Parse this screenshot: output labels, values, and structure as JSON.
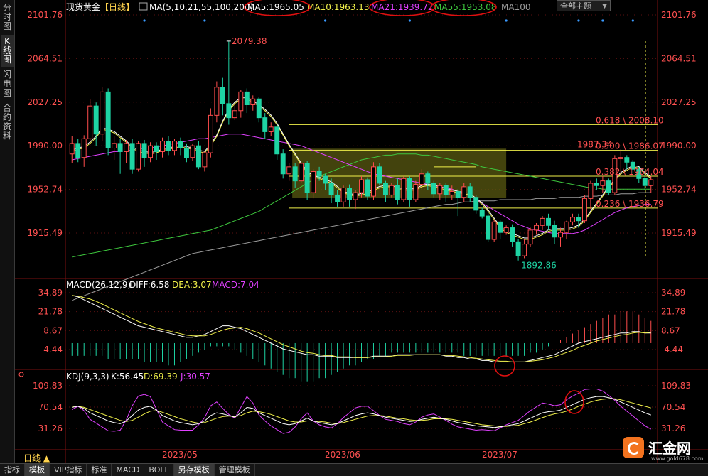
{
  "side_tabs": [
    "分时图",
    "K线图",
    "闪电图",
    "合约资料"
  ],
  "side_active": 1,
  "header": {
    "symbol": "现货黄金",
    "period_tag": "【日线】",
    "ma_label": "MA(5,10,21,55,100,200)",
    "ma5": "MA5:1965.05",
    "ma10": "MA10:1963.13",
    "ma21": "MA21:1939.72",
    "ma55": "MA55:1953.08",
    "ma100": "MA100",
    "theme": "全部主题"
  },
  "colors": {
    "up": "#ff4d4d",
    "down": "#1ed4a4",
    "ma5": "#ffffff",
    "ma10": "#f0f04a",
    "ma21": "#e040ff",
    "ma55": "#3ec83e",
    "ma100": "#9a9a9a",
    "axis_text": "#ff5050",
    "grid": "#5a1010"
  },
  "price_axis": {
    "ticks": [
      "2101.76",
      "2064.51",
      "2027.25",
      "1990.00",
      "1952.74",
      "1915.49"
    ],
    "values": [
      2101.76,
      2064.51,
      2027.25,
      1990.0,
      1952.74,
      1915.49
    ]
  },
  "annotations": {
    "high": "2079.38",
    "low": "1892.86",
    "recent_high": "1987.34"
  },
  "fib": [
    {
      "label": "0.618 \\ 2008.10",
      "value": 2008.1
    },
    {
      "label": "0.500 \\ 1986.07",
      "value": 1986.07
    },
    {
      "label": "0.382 \\ 1964.04",
      "value": 1964.04
    },
    {
      "label": "0.236 \\ 1936.79",
      "value": 1936.79
    }
  ],
  "macd": {
    "label": "MACD(26,12,9)",
    "diff": "DIFF:6.58",
    "dea": "DEA:3.07",
    "macd": "MACD:7.04",
    "ticks": [
      "34.89",
      "21.78",
      "8.67",
      "-4.44"
    ],
    "values": [
      34.89,
      21.78,
      8.67,
      -4.44
    ]
  },
  "kdj": {
    "label": "KDJ(9,3,3)",
    "k": "K:56.45",
    "d": "D:69.39",
    "j": "J:30.57",
    "ticks": [
      "109.83",
      "70.54",
      "31.26"
    ],
    "values": [
      109.83,
      70.54,
      31.26
    ]
  },
  "dates": [
    "2023/05",
    "2023/06",
    "2023/07"
  ],
  "period_button": "日线 ▲",
  "bottom_tabs": [
    "指标",
    "模板",
    "VIP指标",
    "标准",
    "MACD",
    "BOLL",
    "另存模板",
    "管理模板"
  ],
  "bottom_active": [
    1,
    6
  ],
  "logo": {
    "name": "汇金网",
    "url": "www.gold678.com"
  },
  "chart_data": {
    "type": "candlestick",
    "candles": [
      [
        1983,
        1992,
        1975,
        1998
      ],
      [
        1992,
        1980,
        1976,
        1996
      ],
      [
        1980,
        1996,
        1972,
        1999
      ],
      [
        1996,
        2024,
        1994,
        2030
      ],
      [
        2024,
        2000,
        1990,
        2027
      ],
      [
        2000,
        2036,
        1994,
        2040
      ],
      [
        2036,
        1988,
        1982,
        2039
      ],
      [
        1988,
        1992,
        1978,
        1998
      ],
      [
        1992,
        1985,
        1966,
        1996
      ],
      [
        1985,
        1992,
        1975,
        1995
      ],
      [
        1992,
        1970,
        1966,
        1996
      ],
      [
        1970,
        1992,
        1968,
        1994
      ],
      [
        1992,
        1980,
        1972,
        1995
      ],
      [
        1980,
        1990,
        1976,
        1993
      ],
      [
        1990,
        1985,
        1978,
        1993
      ],
      [
        1985,
        1994,
        1980,
        1997
      ],
      [
        1994,
        1986,
        1982,
        1998
      ],
      [
        1986,
        1994,
        1982,
        1996
      ],
      [
        1994,
        1988,
        1982,
        1997
      ],
      [
        1988,
        1980,
        1976,
        1992
      ],
      [
        1980,
        1990,
        1977,
        1992
      ],
      [
        1990,
        1972,
        1970,
        1994
      ],
      [
        1972,
        1984,
        1968,
        1985
      ],
      [
        1984,
        2016,
        1980,
        2022
      ],
      [
        2016,
        2040,
        2010,
        2045
      ],
      [
        2040,
        2026,
        2016,
        2048
      ],
      [
        2026,
        2014,
        2008,
        2079
      ],
      [
        2014,
        2020,
        2012,
        2025
      ],
      [
        2020,
        2036,
        2014,
        2038
      ],
      [
        2036,
        2025,
        2018,
        2039
      ],
      [
        2025,
        2030,
        2020,
        2033
      ],
      [
        2030,
        2014,
        2010,
        2032
      ],
      [
        2014,
        2002,
        1996,
        2018
      ],
      [
        2002,
        2006,
        1998,
        2010
      ],
      [
        2006,
        1983,
        1978,
        2008
      ],
      [
        1983,
        1966,
        1962,
        1987
      ],
      [
        1966,
        1972,
        1960,
        1975
      ],
      [
        1972,
        1960,
        1954,
        1975
      ],
      [
        1960,
        1975,
        1958,
        1976
      ],
      [
        1975,
        1950,
        1944,
        1977
      ],
      [
        1950,
        1968,
        1945,
        1970
      ],
      [
        1968,
        1964,
        1960,
        1972
      ],
      [
        1964,
        1958,
        1952,
        1966
      ],
      [
        1958,
        1948,
        1941,
        1962
      ],
      [
        1948,
        1942,
        1938,
        1952
      ],
      [
        1942,
        1954,
        1938,
        1956
      ],
      [
        1954,
        1944,
        1938,
        1957
      ],
      [
        1944,
        1950,
        1936,
        1952
      ],
      [
        1950,
        1961,
        1946,
        1964
      ],
      [
        1961,
        1947,
        1944,
        1963
      ],
      [
        1947,
        1972,
        1944,
        1976
      ],
      [
        1972,
        1958,
        1956,
        1975
      ],
      [
        1958,
        1948,
        1942,
        1960
      ],
      [
        1948,
        1956,
        1946,
        1958
      ],
      [
        1956,
        1944,
        1940,
        1962
      ],
      [
        1944,
        1962,
        1942,
        1964
      ],
      [
        1962,
        1944,
        1938,
        1964
      ],
      [
        1944,
        1957,
        1942,
        1960
      ],
      [
        1957,
        1966,
        1954,
        1970
      ],
      [
        1966,
        1958,
        1952,
        1968
      ],
      [
        1958,
        1949,
        1946,
        1960
      ],
      [
        1949,
        1956,
        1944,
        1958
      ],
      [
        1956,
        1948,
        1942,
        1958
      ],
      [
        1948,
        1951,
        1944,
        1956
      ],
      [
        1951,
        1946,
        1930,
        1953
      ],
      [
        1946,
        1955,
        1942,
        1958
      ],
      [
        1955,
        1946,
        1942,
        1958
      ],
      [
        1946,
        1935,
        1932,
        1948
      ],
      [
        1935,
        1930,
        1928,
        1937
      ],
      [
        1930,
        1910,
        1908,
        1933
      ],
      [
        1910,
        1925,
        1908,
        1927
      ],
      [
        1925,
        1916,
        1910,
        1927
      ],
      [
        1916,
        1920,
        1914,
        1922
      ],
      [
        1920,
        1908,
        1904,
        1923
      ],
      [
        1908,
        1896,
        1892,
        1910
      ],
      [
        1896,
        1906,
        1894,
        1910
      ],
      [
        1906,
        1918,
        1904,
        1920
      ],
      [
        1918,
        1922,
        1914,
        1924
      ],
      [
        1922,
        1928,
        1918,
        1930
      ],
      [
        1928,
        1922,
        1918,
        1932
      ],
      [
        1922,
        1912,
        1906,
        1926
      ],
      [
        1912,
        1916,
        1904,
        1920
      ],
      [
        1916,
        1925,
        1910,
        1926
      ],
      [
        1925,
        1929,
        1922,
        1932
      ],
      [
        1929,
        1926,
        1920,
        1932
      ],
      [
        1926,
        1945,
        1924,
        1948
      ],
      [
        1945,
        1958,
        1936,
        1960
      ],
      [
        1958,
        1956,
        1952,
        1962
      ],
      [
        1956,
        1960,
        1950,
        1964
      ],
      [
        1960,
        1950,
        1948,
        1962
      ],
      [
        1950,
        1979,
        1948,
        1982
      ],
      [
        1979,
        1980,
        1966,
        1987
      ],
      [
        1980,
        1976,
        1970,
        1982
      ],
      [
        1976,
        1970,
        1966,
        1978
      ],
      [
        1970,
        1962,
        1958,
        1972
      ],
      [
        1962,
        1956,
        1952,
        1966
      ],
      [
        1956,
        1961,
        1950,
        1964
      ]
    ],
    "ma5": [
      1985,
      1987,
      1988,
      1992,
      1997,
      2004,
      2003,
      2001,
      1997,
      1993,
      1988,
      1985,
      1984,
      1983,
      1984,
      1986,
      1987,
      1988,
      1989,
      1988,
      1987,
      1985,
      1984,
      1990,
      1998,
      2010,
      2020,
      2026,
      2030,
      2030,
      2027,
      2024,
      2020,
      2015,
      2008,
      1999,
      1990,
      1982,
      1974,
      1967,
      1963,
      1962,
      1960,
      1958,
      1954,
      1950,
      1948,
      1947,
      1948,
      1949,
      1952,
      1954,
      1955,
      1955,
      1953,
      1952,
      1952,
      1952,
      1955,
      1956,
      1955,
      1954,
      1952,
      1951,
      1950,
      1949,
      1948,
      1944,
      1940,
      1934,
      1927,
      1920,
      1916,
      1914,
      1912,
      1910,
      1910,
      1912,
      1914,
      1917,
      1918,
      1918,
      1918,
      1919,
      1921,
      1926,
      1933,
      1940,
      1947,
      1954,
      1960,
      1966,
      1969,
      1972,
      1971,
      1966,
      1962
    ],
    "ma21": [
      1978,
      1979,
      1980,
      1981,
      1982,
      1983,
      1984,
      1985,
      1985,
      1986,
      1986,
      1987,
      1988,
      1988,
      1989,
      1990,
      1991,
      1992,
      1993,
      1994,
      1995,
      1996,
      1996,
      1997,
      1998,
      1999,
      2000,
      2000,
      2000,
      1999,
      1998,
      1997,
      1996,
      1995,
      1994,
      1993,
      1992,
      1991,
      1990,
      1988,
      1986,
      1984,
      1982,
      1980,
      1978,
      1976,
      1974,
      1972,
      1970,
      1968,
      1966,
      1965,
      1964,
      1963,
      1962,
      1961,
      1960,
      1959,
      1958,
      1957,
      1956,
      1955,
      1954,
      1953,
      1951,
      1949,
      1947,
      1944,
      1941,
      1938,
      1935,
      1932,
      1929,
      1926,
      1923,
      1921,
      1919,
      1918,
      1917,
      1916,
      1915,
      1915,
      1915,
      1915,
      1916,
      1918,
      1921,
      1924,
      1927,
      1930,
      1933,
      1935,
      1937,
      1938,
      1939,
      1940,
      1940
    ],
    "ma55": [
      1895,
      1896,
      1897,
      1898,
      1899,
      1900,
      1901,
      1902,
      1903,
      1904,
      1905,
      1906,
      1907,
      1908,
      1909,
      1910,
      1911,
      1912,
      1913,
      1914,
      1915,
      1916,
      1917,
      1918,
      1920,
      1922,
      1924,
      1926,
      1928,
      1930,
      1932,
      1934,
      1937,
      1940,
      1943,
      1946,
      1949,
      1952,
      1955,
      1958,
      1961,
      1964,
      1966,
      1968,
      1970,
      1972,
      1974,
      1976,
      1978,
      1979,
      1980,
      1981,
      1982,
      1982,
      1983,
      1983,
      1983,
      1983,
      1982,
      1982,
      1981,
      1980,
      1979,
      1978,
      1977,
      1976,
      1975,
      1974,
      1972,
      1971,
      1970,
      1969,
      1968,
      1967,
      1966,
      1965,
      1964,
      1963,
      1962,
      1961,
      1960,
      1959,
      1958,
      1957,
      1956,
      1955,
      1954,
      1954,
      1953,
      1953,
      1953,
      1953,
      1953,
      1953,
      1953,
      1953,
      1953
    ],
    "ma100": [
      1858,
      1860,
      1862,
      1864,
      1866,
      1868,
      1870,
      1872,
      1874,
      1876,
      1878,
      1880,
      1882,
      1884,
      1886,
      1888,
      1890,
      1892,
      1894,
      1896,
      1898,
      1899,
      1900,
      1901,
      1902,
      1903,
      1904,
      1905,
      1906,
      1907,
      1908,
      1909,
      1910,
      1911,
      1912,
      1913,
      1914,
      1915,
      1916,
      1917,
      1918,
      1919,
      1920,
      1921,
      1922,
      1923,
      1924,
      1925,
      1926,
      1927,
      1928,
      1929,
      1930,
      1931,
      1932,
      1933,
      1934,
      1935,
      1936,
      1937,
      1938,
      1939,
      1940,
      1940,
      1941,
      1942,
      1942,
      1943,
      1943,
      1943,
      1943,
      1944,
      1944,
      1944,
      1944,
      1944,
      1944,
      1945,
      1945,
      1945,
      1945,
      1946,
      1946,
      1946,
      1946,
      1947,
      1947,
      1947,
      1948,
      1948,
      1948,
      1949,
      1949,
      1949,
      1950,
      1950,
      1950
    ],
    "macd_hist": [
      -4,
      -4,
      -4,
      -4,
      -4,
      -4,
      -5,
      -5,
      -5,
      -5,
      -5,
      -5,
      -6,
      -6,
      -6,
      -6,
      -7,
      -7,
      -6,
      -5,
      -4,
      -3,
      -2,
      -1,
      -1,
      -1,
      -1,
      -2,
      -3,
      -4,
      -5,
      -6,
      -7,
      -8,
      -9,
      -10,
      -11,
      -11,
      -12,
      -12,
      -12,
      -11,
      -11,
      -10,
      -9,
      -8,
      -7,
      -7,
      -6,
      -5,
      -5,
      -4,
      -4,
      -3,
      -3,
      -3,
      -3,
      -3,
      -3,
      -3,
      -3,
      -3,
      -3,
      -3,
      -3,
      -4,
      -4,
      -4,
      -4,
      -4,
      -4,
      -4,
      -4,
      -4,
      -4,
      -4,
      -3,
      -3,
      -2,
      -1,
      0,
      1,
      2,
      3,
      4,
      5,
      6,
      7,
      8,
      9,
      9,
      10,
      10,
      10,
      9,
      8,
      7
    ],
    "macd_diff": [
      33,
      32,
      30,
      28,
      26,
      24,
      22,
      20,
      18,
      16,
      14,
      12,
      11,
      10,
      9,
      8,
      7,
      6,
      5,
      4,
      4,
      5,
      6,
      8,
      10,
      12,
      12,
      11,
      10,
      8,
      6,
      4,
      2,
      0,
      -2,
      -4,
      -5,
      -6,
      -7,
      -8,
      -8,
      -9,
      -9,
      -9,
      -10,
      -10,
      -10,
      -10,
      -10,
      -10,
      -9,
      -9,
      -9,
      -9,
      -8,
      -8,
      -8,
      -8,
      -8,
      -8,
      -8,
      -8,
      -9,
      -9,
      -10,
      -10,
      -11,
      -11,
      -12,
      -12,
      -13,
      -13,
      -13,
      -13,
      -13,
      -13,
      -12,
      -11,
      -10,
      -9,
      -8,
      -6,
      -4,
      -2,
      0,
      1,
      2,
      3,
      4,
      5,
      6,
      7,
      7,
      8,
      8,
      7,
      7
    ],
    "kdj_k": [
      70,
      72,
      68,
      60,
      55,
      50,
      45,
      42,
      40,
      45,
      55,
      65,
      70,
      72,
      65,
      55,
      50,
      45,
      42,
      40,
      38,
      40,
      45,
      55,
      60,
      58,
      55,
      52,
      60,
      70,
      68,
      60,
      55,
      50,
      45,
      40,
      38,
      40,
      45,
      50,
      45,
      42,
      40,
      38,
      40,
      45,
      50,
      55,
      58,
      60,
      58,
      55,
      52,
      50,
      48,
      46,
      44,
      45,
      48,
      50,
      52,
      50,
      48,
      45,
      42,
      40,
      38,
      36,
      35,
      34,
      33,
      34,
      36,
      38,
      40,
      45,
      50,
      55,
      60,
      62,
      63,
      65,
      70,
      75,
      80,
      85,
      88,
      90,
      90,
      88,
      85,
      80,
      75,
      70,
      65,
      60,
      56
    ],
    "kdj_d": [
      72,
      72,
      70,
      66,
      62,
      58,
      54,
      50,
      46,
      44,
      46,
      52,
      58,
      63,
      64,
      61,
      57,
      53,
      49,
      46,
      43,
      41,
      42,
      46,
      50,
      53,
      54,
      53,
      55,
      60,
      63,
      62,
      60,
      57,
      53,
      49,
      45,
      43,
      43,
      45,
      45,
      44,
      43,
      41,
      40,
      42,
      45,
      48,
      51,
      54,
      55,
      55,
      54,
      52,
      50,
      49,
      47,
      46,
      46,
      47,
      49,
      49,
      49,
      48,
      46,
      44,
      42,
      40,
      38,
      37,
      36,
      35,
      35,
      36,
      37,
      40,
      43,
      47,
      51,
      55,
      58,
      60,
      63,
      67,
      72,
      76,
      80,
      83,
      85,
      86,
      86,
      84,
      81,
      78,
      75,
      72,
      69
    ],
    "kdj_j": [
      66,
      72,
      64,
      48,
      41,
      34,
      27,
      26,
      28,
      47,
      73,
      91,
      94,
      90,
      67,
      43,
      36,
      29,
      28,
      28,
      28,
      38,
      51,
      73,
      80,
      68,
      57,
      50,
      70,
      90,
      78,
      56,
      45,
      36,
      29,
      22,
      24,
      34,
      49,
      60,
      45,
      38,
      34,
      32,
      40,
      51,
      60,
      69,
      72,
      72,
      64,
      55,
      48,
      46,
      44,
      40,
      38,
      43,
      52,
      56,
      58,
      52,
      46,
      39,
      34,
      32,
      30,
      28,
      29,
      28,
      27,
      32,
      38,
      42,
      46,
      55,
      64,
      71,
      78,
      76,
      73,
      75,
      84,
      91,
      96,
      103,
      104,
      104,
      100,
      92,
      83,
      72,
      63,
      54,
      45,
      36,
      30
    ]
  }
}
